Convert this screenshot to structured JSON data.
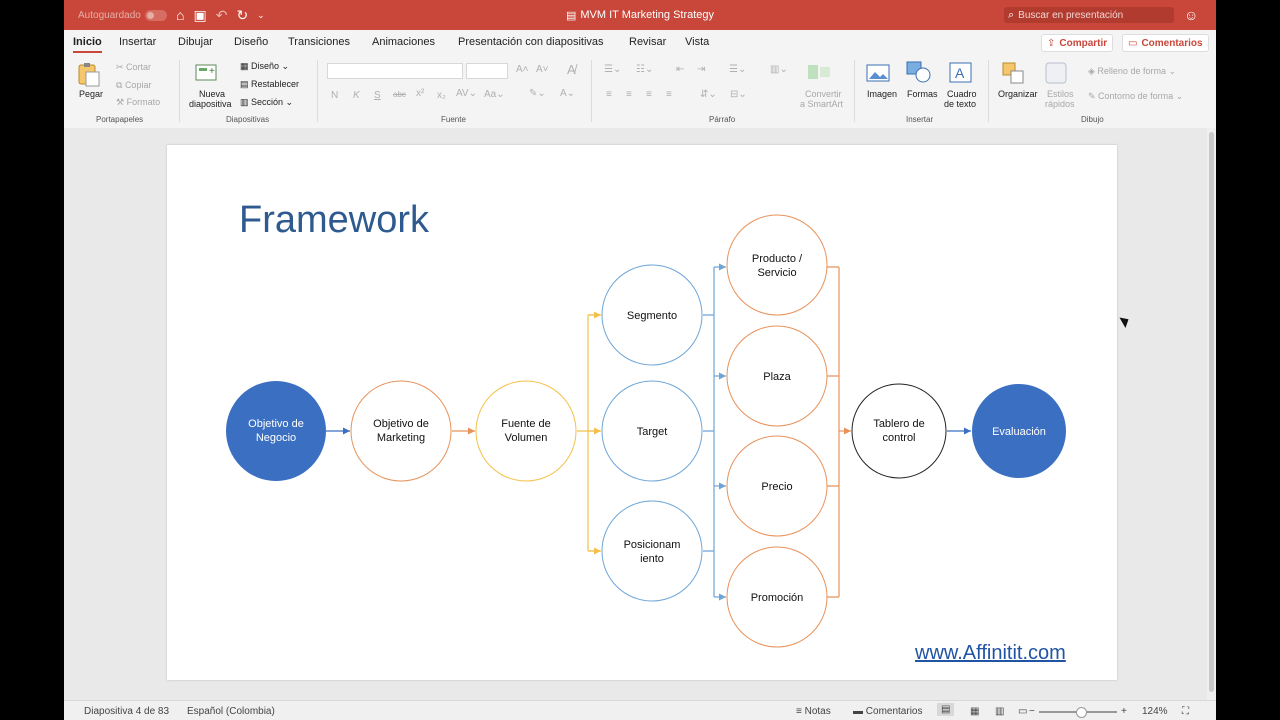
{
  "titlebar": {
    "autosave_label": "Autoguardado",
    "toggle_label": "0",
    "doc_title": "MVM IT Marketing Strategy",
    "search_placeholder": "Buscar en presentación"
  },
  "tabs": [
    "Inicio",
    "Insertar",
    "Dibujar",
    "Diseño",
    "Transiciones",
    "Animaciones",
    "Presentación con diapositivas",
    "Revisar",
    "Vista"
  ],
  "active_tab": "Inicio",
  "share_label": "Compartir",
  "comments_label": "Comentarios",
  "ribbon": {
    "clipboard": {
      "paste": "Pegar",
      "cut": "Cortar",
      "copy": "Copiar",
      "format": "Formato",
      "group": "Portapapeles"
    },
    "slides": {
      "new_line1": "Nueva",
      "new_line2": "diapositiva",
      "design": "Diseño",
      "reset": "Restablecer",
      "section": "Sección",
      "group": "Diapositivas"
    },
    "font": {
      "group": "Fuente",
      "bold": "N",
      "italic": "K",
      "underline": "S",
      "strike": "abc"
    },
    "paragraph": {
      "group": "Párrafo",
      "smartart_line1": "Convertir",
      "smartart_line2": "a SmartArt"
    },
    "insert": {
      "image": "Imagen",
      "shapes": "Formas",
      "textbox_line1": "Cuadro",
      "textbox_line2": "de texto",
      "group": "Insertar"
    },
    "drawing": {
      "arrange": "Organizar",
      "styles_line1": "Estilos",
      "styles_line2": "rápidos",
      "fill": "Relleno de forma",
      "outline": "Contorno de forma",
      "group": "Dibujo"
    }
  },
  "slide": {
    "title": "Framework",
    "link": "www.Affinitit.com",
    "nodes": {
      "obj_negocio": [
        "Objetivo de",
        "Negocio"
      ],
      "obj_marketing": [
        "Objetivo de",
        "Marketing"
      ],
      "fuente": [
        "Fuente de",
        "Volumen"
      ],
      "segmento": [
        "Segmento"
      ],
      "target": [
        "Target"
      ],
      "posicionamiento": [
        "Posicionam",
        "iento"
      ],
      "producto": [
        "Producto /",
        "Servicio"
      ],
      "plaza": [
        "Plaza"
      ],
      "precio": [
        "Precio"
      ],
      "promocion": [
        "Promoción"
      ],
      "tablero": [
        "Tablero de",
        "control"
      ],
      "evaluacion": [
        "Evaluación"
      ]
    },
    "colors": {
      "blue_fill": "#3b6fc2",
      "orange": "#e8925a",
      "yellow": "#f4c04b",
      "light_blue": "#6ea5d6",
      "dark": "#222222"
    }
  },
  "status": {
    "slide_info": "Diapositiva 4 de 83",
    "language": "Español (Colombia)",
    "notes": "Notas",
    "comments": "Comentarios",
    "zoom": "124%"
  }
}
